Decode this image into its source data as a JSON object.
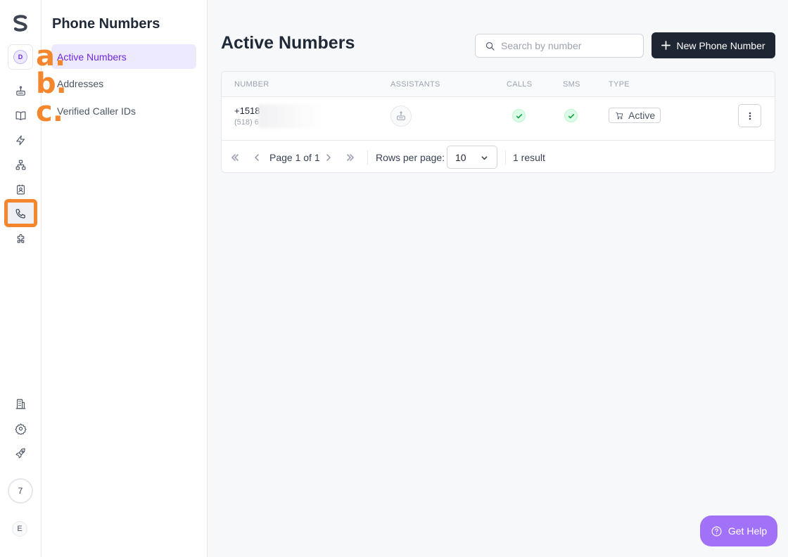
{
  "rail": {
    "workspace_initial": "D",
    "counter": "7",
    "user_initial": "E",
    "icons": [
      "assistants-icon",
      "book-icon",
      "bolt-icon",
      "workflow-icon",
      "contact-card-icon",
      "phone-icon",
      "puzzle-icon",
      "building-icon",
      "gear-icon",
      "rocket-icon"
    ]
  },
  "subnav": {
    "title": "Phone Numbers",
    "items": [
      {
        "label": "Active Numbers",
        "active": true
      },
      {
        "label": "Addresses",
        "active": false
      },
      {
        "label": "Verified Caller IDs",
        "active": false
      }
    ],
    "annotations": [
      "a.",
      "b.",
      "c."
    ]
  },
  "header": {
    "title": "Active Numbers",
    "search_placeholder": "Search by number",
    "new_button_label": "New Phone Number"
  },
  "table": {
    "columns": [
      "NUMBER",
      "ASSISTANTS",
      "CALLS",
      "SMS",
      "TYPE"
    ],
    "rows": [
      {
        "number": "+1518",
        "number_sub": "(518) 6",
        "calls_enabled": true,
        "sms_enabled": true,
        "type": "Active"
      }
    ]
  },
  "pagination": {
    "page_text": "Page 1 of 1",
    "rows_per_page_label": "Rows per page:",
    "rows_per_page_value": "10",
    "result_count": "1 result"
  },
  "help": {
    "label": "Get Help"
  },
  "colors": {
    "accent": "#6d28d9",
    "accent_bg": "#ede9fe",
    "primary_button": "#1e2533",
    "annotation": "#f4872d",
    "help_button": "#a172f7",
    "success": "#16a34a"
  }
}
